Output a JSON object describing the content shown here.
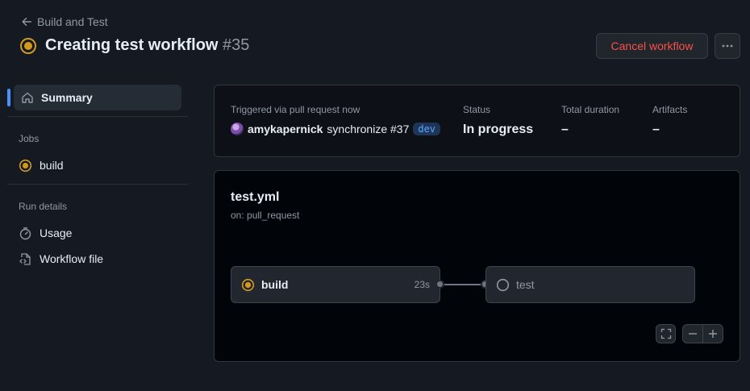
{
  "header": {
    "back_label": "Build and Test",
    "title": "Creating test workflow",
    "run_number": "#35",
    "cancel_label": "Cancel workflow"
  },
  "sidebar": {
    "summary_label": "Summary",
    "jobs_heading": "Jobs",
    "jobs": [
      {
        "label": "build",
        "status": "in_progress"
      }
    ],
    "run_details_heading": "Run details",
    "details": [
      {
        "label": "Usage",
        "icon": "stopwatch-icon"
      },
      {
        "label": "Workflow file",
        "icon": "file-code-icon"
      }
    ]
  },
  "summary": {
    "trigger_label": "Triggered via pull request now",
    "actor": "amykapernick",
    "event": "synchronize #37",
    "branch": "dev",
    "status_label": "Status",
    "status_value": "In progress",
    "duration_label": "Total duration",
    "duration_value": "–",
    "artifacts_label": "Artifacts",
    "artifacts_value": "–"
  },
  "workflow": {
    "file": "test.yml",
    "on": "on: pull_request",
    "jobs": [
      {
        "name": "build",
        "duration": "23s",
        "status": "in_progress"
      },
      {
        "name": "test",
        "duration": "",
        "status": "queued"
      }
    ]
  },
  "colors": {
    "in_progress": "#d29922",
    "danger": "#f85149",
    "accent": "#4493f8"
  }
}
